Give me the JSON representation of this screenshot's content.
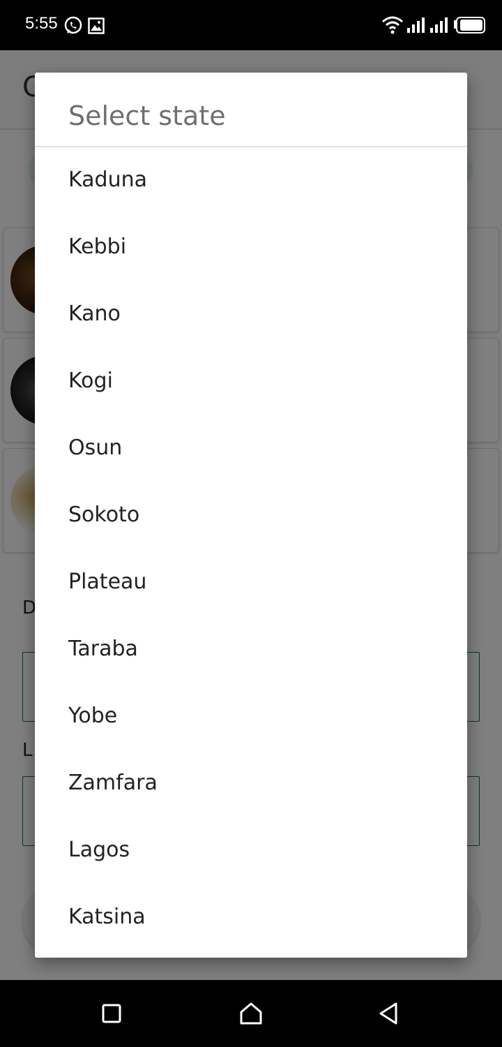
{
  "status_bar": {
    "time": "5:55",
    "icons": [
      "whatsapp-icon",
      "gallery-icon",
      "wifi-icon",
      "signal-icon",
      "signal-icon",
      "battery-icon"
    ]
  },
  "background_app": {
    "header_initial": "C",
    "section_label_1": "D",
    "section_label_2": "L"
  },
  "dialog": {
    "title": "Select state",
    "states": [
      "Kaduna",
      "Kebbi",
      "Kano",
      "Kogi",
      "Osun",
      "Sokoto",
      "Plateau",
      "Taraba",
      "Yobe",
      "Zamfara",
      "Lagos",
      "Katsina"
    ]
  },
  "nav_bar": {
    "buttons": [
      "recents-icon",
      "home-icon",
      "back-icon"
    ]
  },
  "colors": {
    "scrim": "#000000",
    "accent": "#0d6b63",
    "dialog_title": "#6f6f6f",
    "list_text": "#222222"
  }
}
